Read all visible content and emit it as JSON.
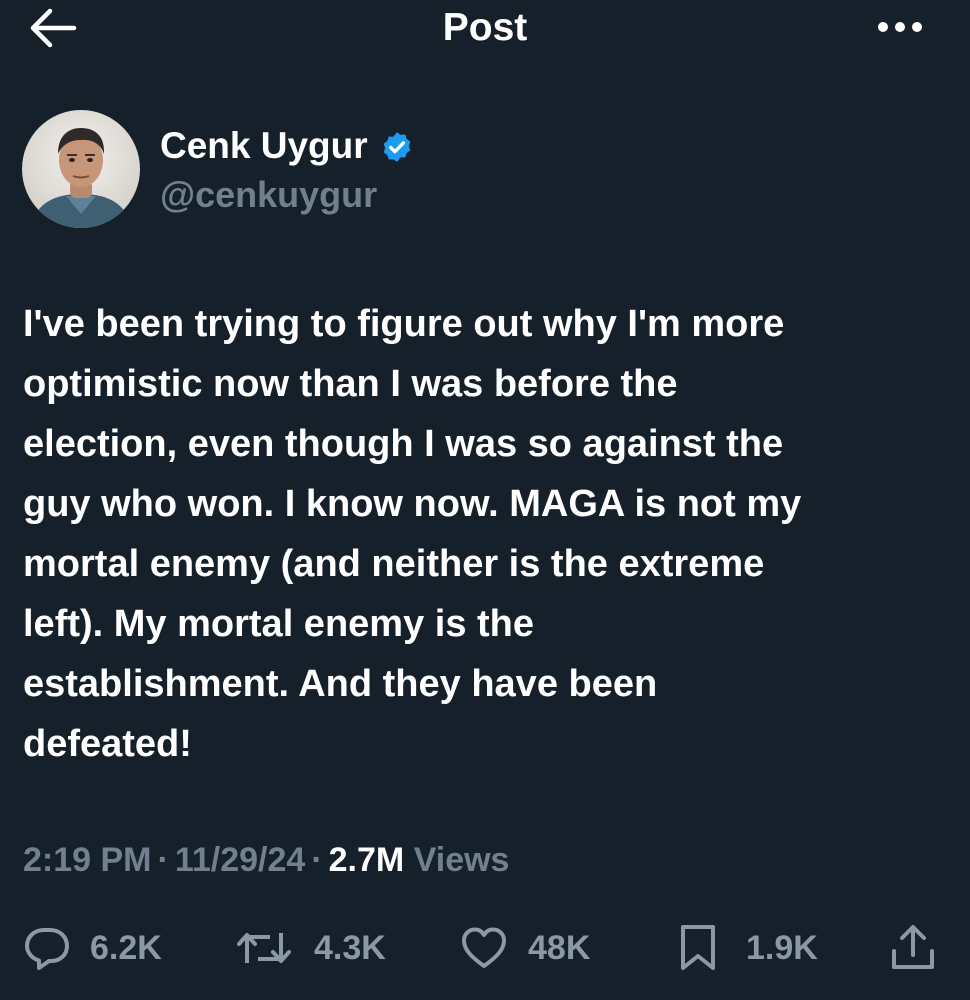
{
  "header": {
    "title": "Post",
    "back_icon": "arrow-left-icon",
    "more_icon": "more-horizontal-icon"
  },
  "author": {
    "name": "Cenk Uygur",
    "handle": "@cenkuygur",
    "verified": true,
    "badge_color": "#1d9bf0"
  },
  "post": {
    "text": "I've been trying to figure out why I'm more\noptimistic now than I was before the\nelection, even though I was so against the\nguy who won. I know now. MAGA is not my\nmortal enemy (and neither is the extreme\nleft). My mortal enemy is the\nestablishment. And they have been\ndefeated!"
  },
  "meta": {
    "time": "2:19 PM",
    "date": "11/29/24",
    "views_count": "2.7M",
    "views_label": "Views",
    "separator": "·"
  },
  "actions": {
    "replies": "6.2K",
    "reposts": "4.3K",
    "likes": "48K",
    "bookmarks": "1.9K",
    "share_icon": "share-icon"
  },
  "colors": {
    "background": "#16202b",
    "text": "#ffffff",
    "muted": "#71808f",
    "accent": "#1d9bf0"
  }
}
